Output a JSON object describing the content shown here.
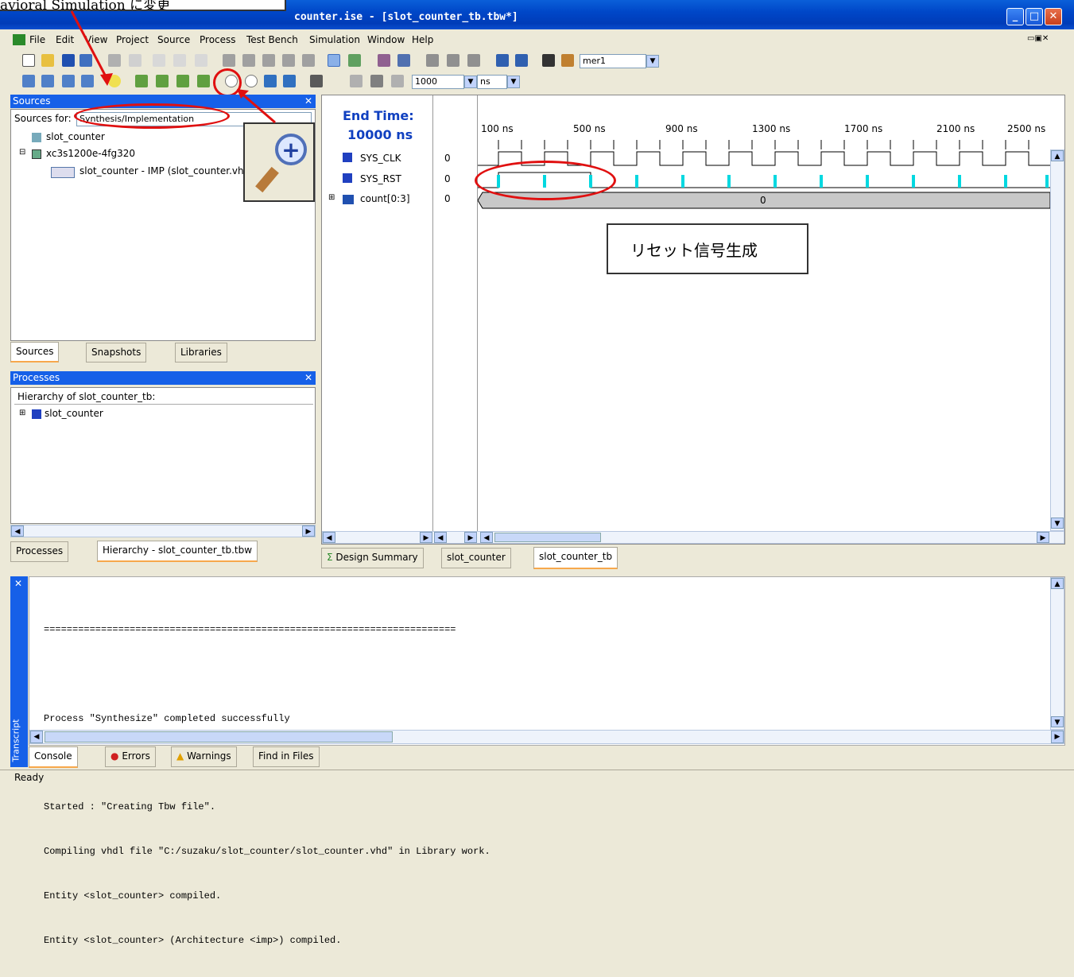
{
  "window": {
    "title": "counter.ise - [slot_counter_tb.tbw*]"
  },
  "callout_top": "avioral Simulation に変更",
  "menu": [
    "File",
    "Edit",
    "View",
    "Project",
    "Source",
    "Process",
    "Test Bench",
    "Simulation",
    "Window",
    "Help"
  ],
  "toolbar": {
    "search_value": "mer1",
    "time_value": "1000",
    "unit_value": "ns"
  },
  "sources": {
    "header": "Sources",
    "for_label": "Sources for:",
    "for_value": "Synthesis/Implementation",
    "tree": [
      "slot_counter",
      "xc3s1200e-4fg320",
      "slot_counter - IMP (slot_counter.vhd"
    ],
    "tabs": [
      "Sources",
      "Snapshots",
      "Libraries"
    ]
  },
  "processes": {
    "header": "Processes",
    "hierarchy_label": "Hierarchy of slot_counter_tb:",
    "tree": [
      "slot_counter"
    ],
    "tabs": [
      "Processes",
      "Hierarchy - slot_counter_tb.tbw"
    ]
  },
  "wave": {
    "end_time_label": "End Time:",
    "end_time_value": "10000 ns",
    "ticks": [
      "100 ns",
      "500 ns",
      "900 ns",
      "1300 ns",
      "1700 ns",
      "2100 ns",
      "2500 ns"
    ],
    "signals": [
      {
        "name": "SYS_CLK",
        "value": "0"
      },
      {
        "name": "SYS_RST",
        "value": "0"
      },
      {
        "name": "count[0:3]",
        "value": "0"
      }
    ],
    "bus_value": "0",
    "annotation": "リセット信号生成"
  },
  "doc_tabs": [
    "Design Summary",
    "slot_counter",
    "slot_counter_tb"
  ],
  "transcript": {
    "side_label": "Transcript",
    "lines": [
      "========================================================================",
      "",
      "Process \"Synthesize\" completed successfully",
      "",
      "Started : \"Creating Tbw file\".",
      "Compiling vhdl file \"C:/suzaku/slot_counter/slot_counter.vhd\" in Library work.",
      "Entity <slot_counter> compiled.",
      "Entity <slot_counter> (Architecture <imp>) compiled."
    ],
    "tabs": [
      "Console",
      "Errors",
      "Warnings",
      "Find in Files"
    ]
  },
  "status": "Ready",
  "colors": {
    "accent": "#1660e8",
    "highlight": "#e01010",
    "wave": "#000000",
    "rst_marker": "#00d8e0"
  }
}
